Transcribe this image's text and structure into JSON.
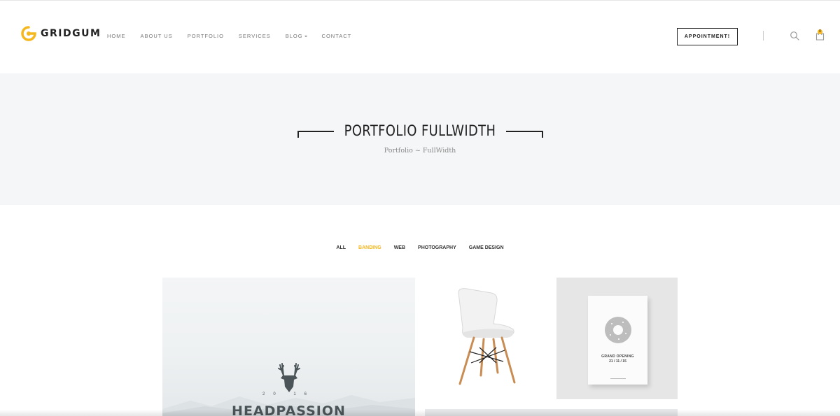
{
  "brand": {
    "name": "GRIDGUM",
    "accent": "#f5b71e"
  },
  "nav": {
    "items": [
      {
        "label": "HOME"
      },
      {
        "label": "ABOUT US"
      },
      {
        "label": "PORTFOLIO"
      },
      {
        "label": "SERVICES"
      },
      {
        "label": "BLOG",
        "has_dropdown": true
      },
      {
        "label": "CONTACT"
      }
    ]
  },
  "header": {
    "appointment_label": "APPOINTMENT!",
    "cart_count": "0",
    "icons": [
      "search-icon",
      "cart-icon"
    ]
  },
  "hero": {
    "title": "PORTFOLIO FULLWIDTH",
    "breadcrumb": "Portfolio ~ FullWidth"
  },
  "filters": {
    "items": [
      "ALL",
      "BANDING",
      "WEB",
      "PHOTOGRAPHY",
      "GAME DESIGN"
    ],
    "active": "BANDING"
  },
  "portfolio": {
    "card1": {
      "year": "20 16",
      "brand": "HEADPASSION"
    },
    "card3": {
      "line1": "GRAND OPENING",
      "line2": "21 / 11 / 15"
    }
  }
}
